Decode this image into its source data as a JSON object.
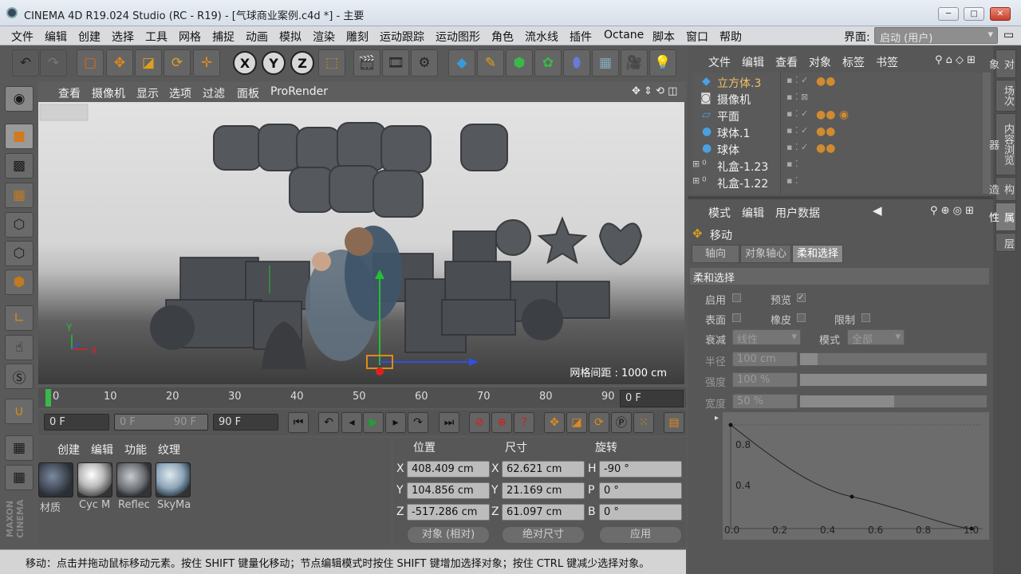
{
  "window": {
    "title": "CINEMA 4D R19.024 Studio (RC - R19) - [气球商业案例.c4d *] - 主要",
    "btn_min": "─",
    "btn_max": "□",
    "btn_close": "✕"
  },
  "menu": {
    "items": [
      "文件",
      "编辑",
      "创建",
      "选择",
      "工具",
      "网格",
      "捕捉",
      "动画",
      "模拟",
      "渲染",
      "雕刻",
      "运动跟踪",
      "运动图形",
      "角色",
      "流水线",
      "插件",
      "Octane",
      "脚本",
      "窗口",
      "帮助"
    ],
    "interface_label": "界面:",
    "interface_value": "启动 (用户)"
  },
  "toolbar": {
    "x": "X",
    "y": "Y",
    "z": "Z"
  },
  "viewport": {
    "menu": [
      "查看",
      "摄像机",
      "显示",
      "选项",
      "过滤",
      "面板",
      "ProRender"
    ],
    "grid_label": "网格间距 : 1000 cm",
    "axis_y": "Y",
    "axis_x": "X"
  },
  "timeline": {
    "ticks": [
      "0",
      "10",
      "20",
      "30",
      "40",
      "50",
      "60",
      "70",
      "80",
      "90"
    ],
    "current": "0 F"
  },
  "playback": {
    "start": "0 F",
    "range_start": "0 F",
    "range_end": "90 F",
    "end": "90 F"
  },
  "materials": {
    "menu": [
      "创建",
      "编辑",
      "功能",
      "纹理"
    ],
    "items": [
      "材质",
      "Cyc M",
      "Reflec",
      "SkyMa"
    ]
  },
  "coords": {
    "headers": [
      "位置",
      "尺寸",
      "旋转"
    ],
    "rows": [
      {
        "axis": "X",
        "pos": "408.409 cm",
        "size_axis": "X",
        "size": "62.621 cm",
        "rot_axis": "H",
        "rot": "-90 °"
      },
      {
        "axis": "Y",
        "pos": "104.856 cm",
        "size_axis": "Y",
        "size": "21.169 cm",
        "rot_axis": "P",
        "rot": "0 °"
      },
      {
        "axis": "Z",
        "pos": "-517.286 cm",
        "size_axis": "Z",
        "size": "61.097 cm",
        "rot_axis": "B",
        "rot": "0 °"
      }
    ],
    "mode": "对象 (相对)",
    "size_mode": "绝对尺寸",
    "apply": "应用"
  },
  "status": "移动：点击并拖动鼠标移动元素。按住 SHIFT 键量化移动；节点编辑模式时按住 SHIFT 键增加选择对象；按住 CTRL 键减少选择对象。",
  "objects": {
    "menu": [
      "文件",
      "编辑",
      "查看",
      "对象",
      "标签",
      "书签"
    ],
    "items": [
      {
        "name": "立方体.3"
      },
      {
        "name": "摄像机"
      },
      {
        "name": "平面"
      },
      {
        "name": "球体.1"
      },
      {
        "name": "球体"
      },
      {
        "name": "礼盒-1.23"
      },
      {
        "name": "礼盒-1.22"
      }
    ]
  },
  "attributes": {
    "menu": [
      "模式",
      "编辑",
      "用户数据"
    ],
    "tool": "移动",
    "tabs": [
      "轴向",
      "对象轴心",
      "柔和选择"
    ],
    "section": "柔和选择",
    "enable": "启用",
    "preview": "预览",
    "surface": "表面",
    "rubber": "橡皮",
    "limit": "限制",
    "falloff_label": "衰减",
    "falloff_value": "线性",
    "mode_label": "模式",
    "mode_value": "全部",
    "radius_label": "半径",
    "radius_value": "100 cm",
    "strength_label": "强度",
    "strength_value": "100 %",
    "width_label": "宽度",
    "width_value": "50 %",
    "curve_y": [
      "0.8",
      "0.4"
    ],
    "curve_x": [
      "0.0",
      "0.2",
      "0.4",
      "0.6",
      "0.8",
      "1.0"
    ],
    "curve_handle": "▸"
  },
  "side_tabs": [
    "对象",
    "场次",
    "内容浏览器",
    "构造",
    "属性",
    "层"
  ],
  "logo": "MAXON CINEMA"
}
